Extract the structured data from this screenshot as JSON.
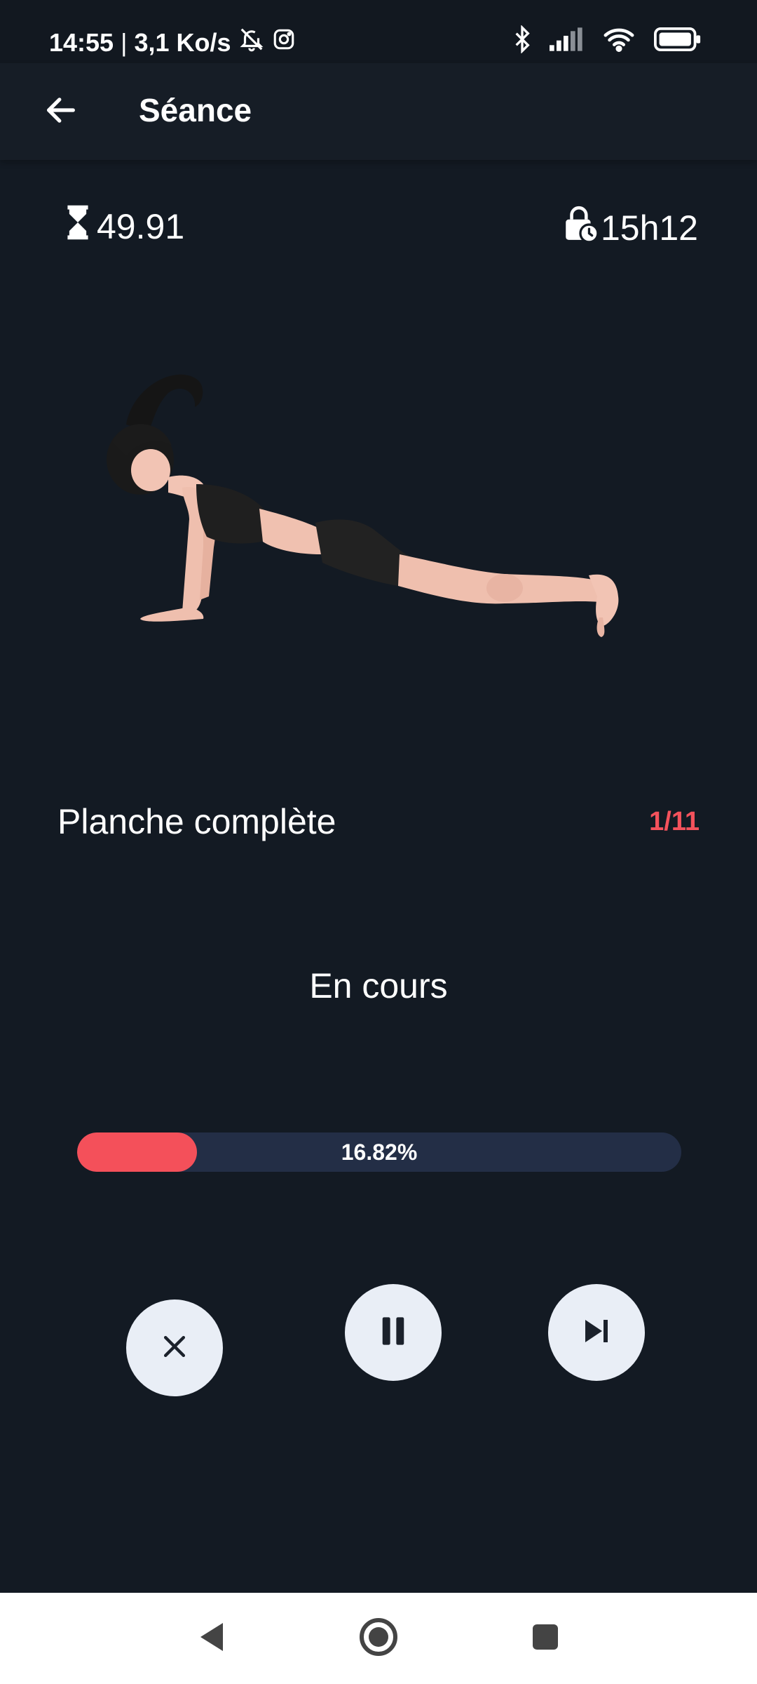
{
  "status_bar": {
    "time": "14:55",
    "separator": "|",
    "network_speed": "3,1 Ko/s",
    "icons": [
      "bell-off-icon",
      "instagram-icon",
      "bluetooth-icon",
      "signal-icon",
      "wifi-icon",
      "battery-icon"
    ]
  },
  "app_bar": {
    "title": "Séance",
    "back_icon": "arrow-left-icon"
  },
  "stats": {
    "timer_icon": "hourglass-icon",
    "timer_value": "49.91",
    "time_icon": "lock-clock-icon",
    "time_value": "15h12"
  },
  "exercise": {
    "name": "Planche complète",
    "counter": "1/11",
    "state": "En cours",
    "image": "plank-figure"
  },
  "progress": {
    "value": 0.1682,
    "label": "16.82%"
  },
  "controls": [
    {
      "name": "close",
      "icon": "close-icon"
    },
    {
      "name": "pause",
      "icon": "pause-icon"
    },
    {
      "name": "skip-next",
      "icon": "skip-next-icon"
    }
  ],
  "nav_bar": {
    "icons": [
      "nav-back-icon",
      "nav-home-icon",
      "nav-recents-icon"
    ]
  },
  "colors": {
    "background": "#131a23",
    "accent": "#f4525c",
    "progress_track": "#232e46",
    "button_bg": "#e9eef6"
  }
}
